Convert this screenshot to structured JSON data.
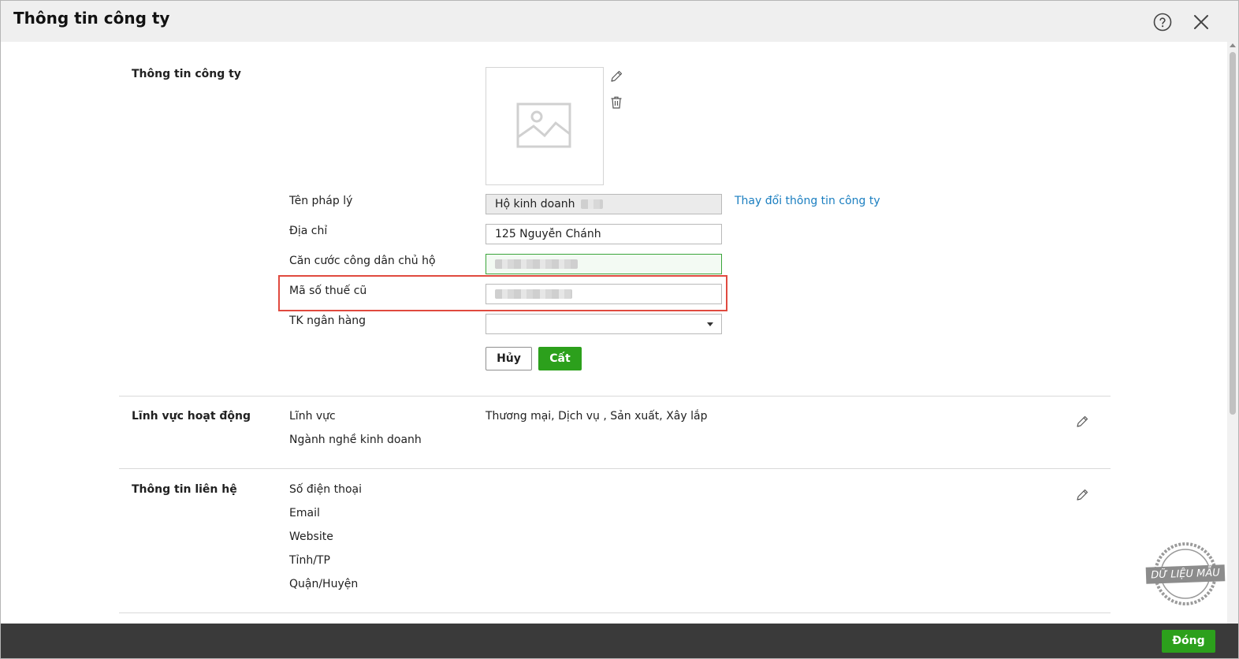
{
  "dialog": {
    "title": "Thông tin công ty"
  },
  "company": {
    "section_title": "Thông tin công ty",
    "legal_name_label": "Tên pháp lý",
    "legal_name_value": "Hộ kinh doanh",
    "change_link": "Thay đổi thông tin công ty",
    "address_label": "Địa chỉ",
    "address_value": "125 Nguyễn Chánh",
    "id_card_label": "Căn cước công dân chủ hộ",
    "old_tax_label": "Mã số thuế cũ",
    "bank_label": "TK ngân hàng",
    "bank_value": "",
    "cancel_label": "Hủy",
    "save_label": "Cất"
  },
  "business": {
    "section_title": "Lĩnh vực hoạt động",
    "field_label": "Lĩnh vực",
    "field_value": "Thương mại, Dịch vụ , Sản xuất, Xây lắp",
    "industry_label": "Ngành nghề kinh doanh"
  },
  "contact": {
    "section_title": "Thông tin liên hệ",
    "phone_label": "Số điện thoại",
    "email_label": "Email",
    "website_label": "Website",
    "province_label": "Tỉnh/TP",
    "district_label": "Quận/Huyện"
  },
  "stamp": {
    "text": "DỮ LIỆU MẪU"
  },
  "footer": {
    "close_label": "Đóng"
  },
  "colors": {
    "accent_green": "#2ca01c",
    "link_blue": "#1a7ec0",
    "highlight_red": "#e04a3f"
  }
}
